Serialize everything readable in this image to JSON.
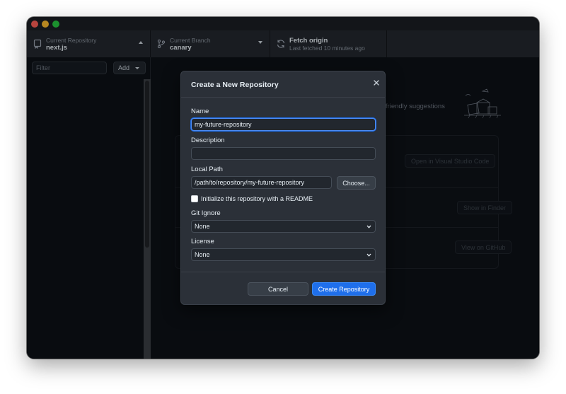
{
  "window": {
    "controls": [
      "close",
      "minimize",
      "zoom"
    ]
  },
  "toolbar": {
    "repository": {
      "label": "Current Repository",
      "value": "next.js",
      "icon": "repo-icon"
    },
    "branch": {
      "label": "Current Branch",
      "value": "canary",
      "icon": "branch-icon"
    },
    "fetch": {
      "label": "Fetch origin",
      "status": "Last fetched 10 minutes ago",
      "icon": "sync-icon"
    }
  },
  "sidebar": {
    "filter_placeholder": "Filter",
    "add_label": "Add"
  },
  "main": {
    "hint_text": "e friendly suggestions",
    "actions": [
      {
        "label": "Open in Visual Studio Code"
      },
      {
        "label": "Show in Finder"
      },
      {
        "label": "View on GitHub"
      }
    ]
  },
  "dialog": {
    "title": "Create a New Repository",
    "name_label": "Name",
    "name_value": "my-future-repository",
    "description_label": "Description",
    "description_value": "",
    "local_path_label": "Local Path",
    "local_path_value": "/path/to/repository/my-future-repository",
    "choose_label": "Choose...",
    "readme_label": "Initialize this repository with a README",
    "readme_checked": false,
    "gitignore_label": "Git Ignore",
    "gitignore_value": "None",
    "license_label": "License",
    "license_value": "None",
    "cancel_label": "Cancel",
    "create_label": "Create Repository"
  },
  "colors": {
    "accent": "#1f6feb",
    "background": "#0d1117",
    "dialog": "#2b3038"
  }
}
